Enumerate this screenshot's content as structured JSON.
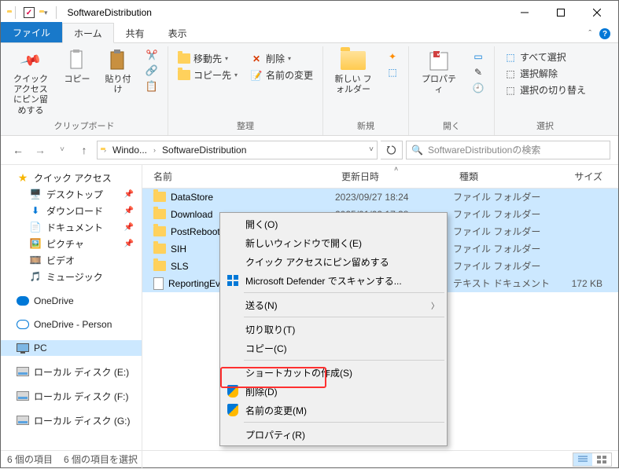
{
  "window": {
    "title": "SoftwareDistribution"
  },
  "tabs": {
    "file": "ファイル",
    "home": "ホーム",
    "share": "共有",
    "view": "表示"
  },
  "ribbon": {
    "clipboard": {
      "quick_access": "クイック アクセス\nにピン留めする",
      "copy": "コピー",
      "paste": "貼り付け",
      "label": "クリップボード"
    },
    "organize": {
      "move": "移動先",
      "copy_to": "コピー先",
      "delete": "削除",
      "rename": "名前の変更",
      "label": "整理"
    },
    "new": {
      "new_folder": "新しい\nフォルダー",
      "label": "新規"
    },
    "open": {
      "properties": "プロパティ",
      "label": "開く"
    },
    "select": {
      "select_all": "すべて選択",
      "select_none": "選択解除",
      "invert": "選択の切り替え",
      "label": "選択"
    }
  },
  "address": {
    "crumb1": "Windo...",
    "crumb2": "SoftwareDistribution",
    "search_placeholder": "SoftwareDistributionの検索"
  },
  "sidebar": {
    "quick_access": "クイック アクセス",
    "desktop": "デスクトップ",
    "downloads": "ダウンロード",
    "documents": "ドキュメント",
    "pictures": "ピクチャ",
    "videos": "ビデオ",
    "music": "ミュージック",
    "onedrive": "OneDrive",
    "onedrive_personal": "OneDrive - Person",
    "pc": "PC",
    "disk_e": "ローカル ディスク (E:)",
    "disk_f": "ローカル ディスク (F:)",
    "disk_g": "ローカル ディスク (G:)"
  },
  "columns": {
    "name": "名前",
    "date": "更新日時",
    "type": "種類",
    "size": "サイズ"
  },
  "files": [
    {
      "name": "DataStore",
      "date": "2023/09/27 18:24",
      "type": "ファイル フォルダー",
      "size": "",
      "icon": "folder"
    },
    {
      "name": "Download",
      "date": "2025/01/02 17:38",
      "type": "ファイル フォルダー",
      "size": "",
      "icon": "folder"
    },
    {
      "name": "PostRebootEve",
      "date": "",
      "type": "ファイル フォルダー",
      "size": "",
      "icon": "folder"
    },
    {
      "name": "SIH",
      "date": "",
      "type": "ファイル フォルダー",
      "size": "",
      "icon": "folder"
    },
    {
      "name": "SLS",
      "date": "",
      "type": "ファイル フォルダー",
      "size": "",
      "icon": "folder"
    },
    {
      "name": "ReportingEven",
      "date": "",
      "type": "テキスト ドキュメント",
      "size": "172 KB",
      "icon": "file"
    }
  ],
  "context_menu": {
    "open": "開く(O)",
    "open_new_window": "新しいウィンドウで開く(E)",
    "pin_quick_access": "クイック アクセスにピン留めする",
    "defender_scan": "Microsoft Defender でスキャンする...",
    "send_to": "送る(N)",
    "cut": "切り取り(T)",
    "copy": "コピー(C)",
    "create_shortcut": "ショートカットの作成(S)",
    "delete": "削除(D)",
    "rename": "名前の変更(M)",
    "properties": "プロパティ(R)"
  },
  "statusbar": {
    "item_count": "6 個の項目",
    "selected_count": "6 個の項目を選択"
  }
}
